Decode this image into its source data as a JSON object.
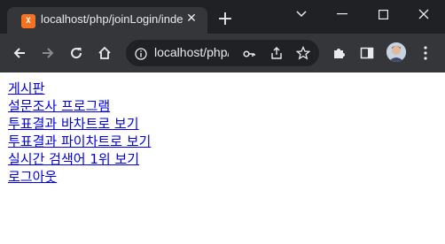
{
  "tab": {
    "favicon_text": "X",
    "title": "localhost/php/joinLogin/index.php",
    "close_glyph": "✕"
  },
  "new_tab_glyph": "+",
  "address_bar": {
    "url": "localhost/php/joinLogin/index.php"
  },
  "page": {
    "links": [
      "게시판",
      "설문조사 프로그램",
      "투표결과 바차트로 보기",
      "투표결과 파이차트로 보기",
      "실시간 검색어 1위 보기",
      "로그아웃"
    ]
  },
  "colors": {
    "titlebar": "#202124",
    "toolbar": "#35363a",
    "link": "#0000ee",
    "favicon": "#f57224"
  }
}
